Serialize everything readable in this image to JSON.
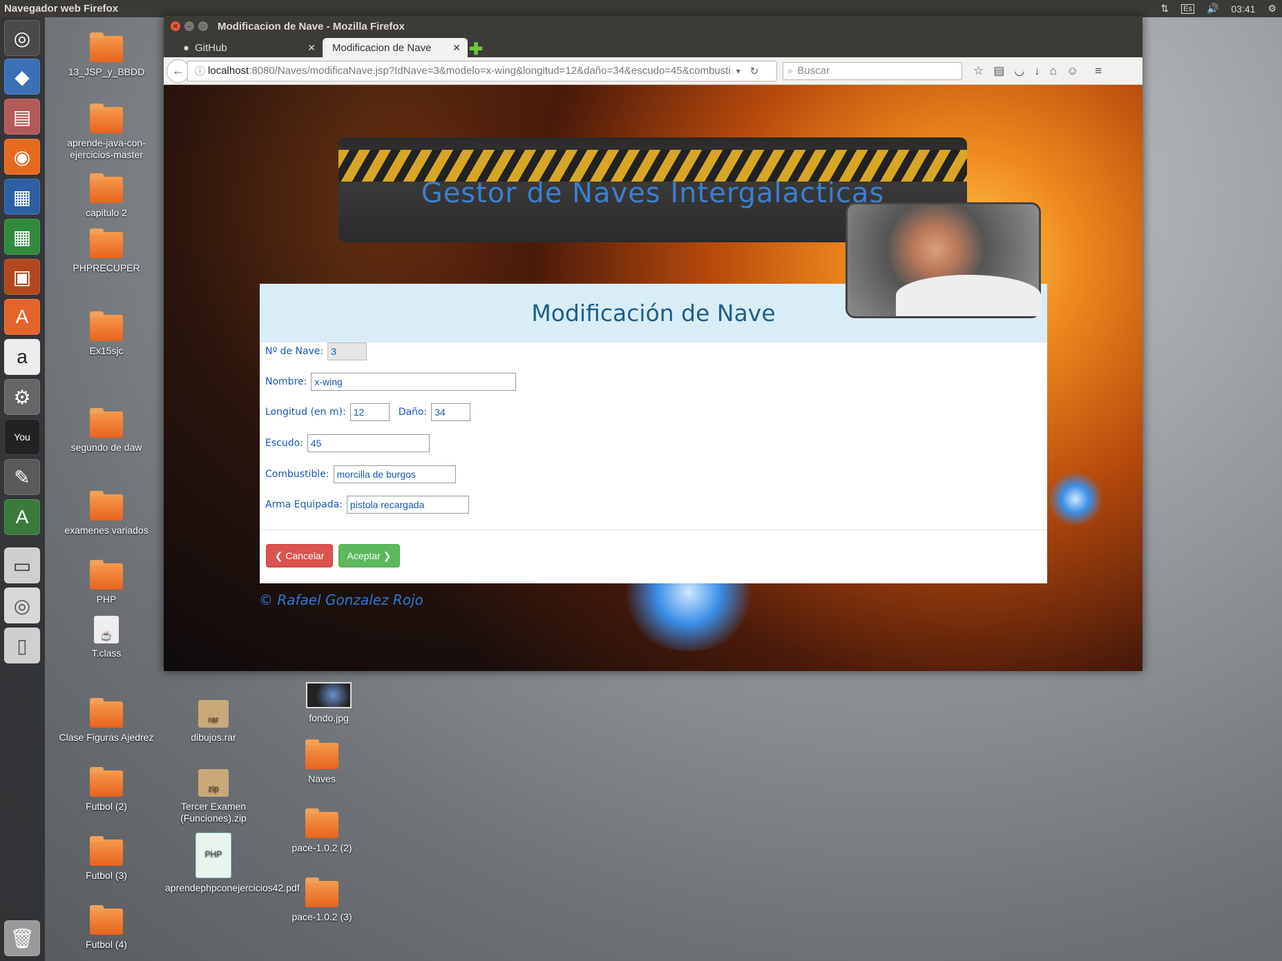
{
  "top_panel": {
    "title": "Navegador web Firefox",
    "keyboard": "Es",
    "time": "03:41"
  },
  "launcher": {
    "items": [
      "ubuntu-dash",
      "virtualbox",
      "files",
      "firefox",
      "writer",
      "calc",
      "impress",
      "software-center",
      "amazon",
      "system-settings",
      "youtube",
      "gimp",
      "software-updater",
      "floppy",
      "dvd",
      "usb",
      "trash"
    ]
  },
  "desktop": {
    "icons": [
      {
        "label": "13_JSP_y_BBDD",
        "kind": "folder"
      },
      {
        "label": "aprende-java-con-ejercicios-master",
        "kind": "folder"
      },
      {
        "label": "capitulo 2",
        "kind": "folder"
      },
      {
        "label": "PHPRECUPER",
        "kind": "folder"
      },
      {
        "label": "Ex15sjc",
        "kind": "folder"
      },
      {
        "label": "segundo de daw",
        "kind": "folder"
      },
      {
        "label": "examenes variados",
        "kind": "folder"
      },
      {
        "label": "PHP",
        "kind": "folder"
      },
      {
        "label": "T.class",
        "kind": "file"
      },
      {
        "label": "Clase Figuras Ajedrez",
        "kind": "folder"
      },
      {
        "label": "Futbol (2)",
        "kind": "folder"
      },
      {
        "label": "Futbol (3)",
        "kind": "folder"
      },
      {
        "label": "Futbol (4)",
        "kind": "folder"
      },
      {
        "label": "dibujos.rar",
        "kind": "rar"
      },
      {
        "label": "Tercer Examen (Funciones).zip",
        "kind": "zip"
      },
      {
        "label": "aprendephpconejercicios42.pdf",
        "kind": "pdf"
      },
      {
        "label": "fondo.jpg",
        "kind": "image"
      },
      {
        "label": "Naves",
        "kind": "folder"
      },
      {
        "label": "pace-1.0.2 (2)",
        "kind": "folder"
      },
      {
        "label": "pace-1.0.2 (3)",
        "kind": "folder"
      }
    ],
    "archive_labels": {
      "rar": "rar",
      "zip": "zip",
      "pdf": "PHP"
    }
  },
  "browser": {
    "window_title": "Modificacion de Nave - Mozilla Firefox",
    "tabs": [
      {
        "label": "GitHub",
        "active": false
      },
      {
        "label": "Modificacion de Nave",
        "active": true
      }
    ],
    "url_host": "localhost",
    "url_rest": ":8080/Naves/modificaNave.jsp?IdNave=3&modelo=x-wing&longitud=12&daño=34&escudo=45&combusti",
    "search_placeholder": "Buscar"
  },
  "page": {
    "banner_title": "Gestor de Naves Intergalacticas",
    "panel_title": "Modificación de Nave",
    "fields": {
      "id": {
        "label": "Nº de Nave:",
        "value": "3"
      },
      "nombre": {
        "label": "Nombre:",
        "value": "x-wing"
      },
      "longitud": {
        "label": "Longitud (en m):",
        "value": "12"
      },
      "dano": {
        "label": "Daño:",
        "value": "34"
      },
      "escudo": {
        "label": "Escudo:",
        "value": "45"
      },
      "combustible": {
        "label": "Combustible:",
        "value": "morcilla de burgos"
      },
      "arma": {
        "label": "Arma Equipada:",
        "value": "pistola recargada"
      }
    },
    "buttons": {
      "cancel": "Cancelar",
      "accept": "Aceptar"
    },
    "footer": "© Rafael Gonzalez Rojo"
  },
  "colors": {
    "accent": "#3b7fd0",
    "cancel": "#d9534f",
    "accept": "#5cb85c",
    "panel_head": "#d9edf7"
  }
}
